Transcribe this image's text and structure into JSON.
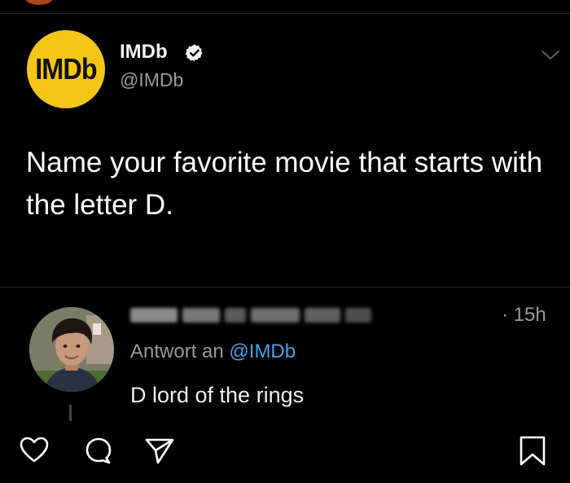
{
  "post": {
    "logo_text": "IMDb",
    "author_name": "IMDb",
    "author_handle": "@IMDb",
    "text": "Name your favorite movie that starts with the letter D."
  },
  "reply": {
    "time": "· 15h",
    "reply_prefix": "Antwort an ",
    "reply_mention": "@IMDb",
    "text": "D lord of the rings"
  },
  "colors": {
    "background": "#000000",
    "imdb_yellow": "#f5c518",
    "mention_blue": "#4a9fe6",
    "muted_text": "#9a9a9a"
  },
  "icons": [
    "verified-badge-icon",
    "chevron-down-icon",
    "heart-icon",
    "comment-icon",
    "share-icon",
    "bookmark-icon"
  ]
}
